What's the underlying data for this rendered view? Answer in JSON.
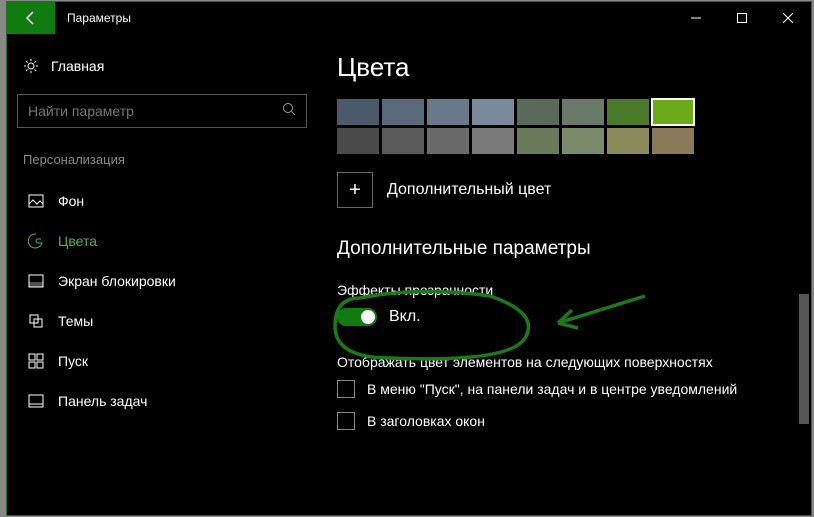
{
  "titlebar": {
    "title": "Параметры"
  },
  "sidebar": {
    "home": "Главная",
    "search_placeholder": "Найти параметр",
    "section": "Персонализация",
    "items": [
      {
        "label": "Фон"
      },
      {
        "label": "Цвета"
      },
      {
        "label": "Экран блокировки"
      },
      {
        "label": "Темы"
      },
      {
        "label": "Пуск"
      },
      {
        "label": "Панель задач"
      }
    ]
  },
  "content": {
    "heading": "Цвета",
    "row1": [
      "#4a5a6a",
      "#5a6a7a",
      "#6a7a8a",
      "#7a8a9a",
      "#5a6a5a",
      "#6a7a6a",
      "#4a7a2a",
      "#6aaa1a"
    ],
    "row2": [
      "#4a4a4a",
      "#5a5a5a",
      "#6a6a6a",
      "#7a7a7a",
      "#6a7a5a",
      "#7a8a6a",
      "#8a8a5a",
      "#8a7a5a"
    ],
    "selected_index": 7,
    "add_color": "Дополнительный цвет",
    "add_btn": "+",
    "subheading": "Дополнительные параметры",
    "transparency_label": "Эффекты прозрачности",
    "transparency_state": "Вкл.",
    "show_on_label": "Отображать цвет элементов на следующих поверхностях",
    "check1": "В меню \"Пуск\", на панели задач и в центре уведомлений",
    "check2": "В заголовках окон"
  }
}
